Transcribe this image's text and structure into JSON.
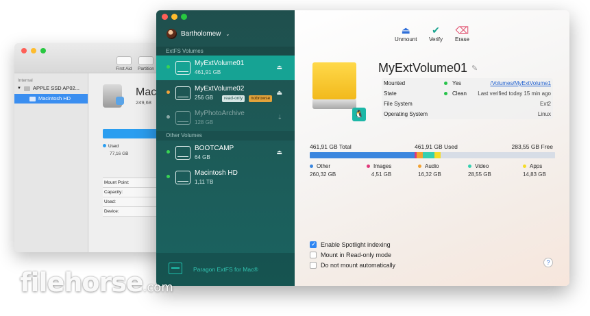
{
  "background_window": {
    "toolbar": [
      "First Aid",
      "Partition"
    ],
    "sidebar_section": "Internal",
    "sidebar_items": [
      "APPLE SSD AP02...",
      "Macintosh HD"
    ],
    "disk_name": "Macin",
    "disk_size": "249,68",
    "used_label": "Used",
    "used_value": "77,16 GB",
    "info_rows": [
      "Mount Point:",
      "Capacity:",
      "Used:",
      "Device:"
    ]
  },
  "sidebar": {
    "user": "Bartholomew",
    "sections": {
      "extfs": "ExtFS Volumes",
      "other": "Other Volumes"
    },
    "volumes": [
      {
        "name": "MyExtVolume01",
        "size": "461,91 GB",
        "status_color": "#39d353"
      },
      {
        "name": "MyExtVolume02",
        "size": "256 GB",
        "status_color": "#f3a33a",
        "badges": [
          "read-only",
          "nobrowse"
        ]
      },
      {
        "name": "MyPhotoArchive",
        "size": "128 GB",
        "status_color": "#8aa8a6"
      },
      {
        "name": "BOOTCAMP",
        "size": "64 GB",
        "status_color": "#39d353"
      },
      {
        "name": "Macintosh HD",
        "size": "1,11 TB",
        "status_color": "#39d353"
      }
    ],
    "brand": "Paragon ExtFS for Mac®"
  },
  "toolbar": {
    "unmount": "Unmount",
    "verify": "Verify",
    "erase": "Erase"
  },
  "volume": {
    "title": "MyExtVolume01",
    "info": {
      "mounted_label": "Mounted",
      "mounted_value": "Yes",
      "mount_path": "/Volumes/MyExtVolume1",
      "state_label": "State",
      "state_value": "Clean",
      "state_note": "Last verified today 15 min ago",
      "fs_label": "File System",
      "fs_value": "Ext2",
      "os_label": "Operating System",
      "os_value": "Linux"
    }
  },
  "capacity": {
    "total": "461,91 GB Total",
    "used": "461,91 GB Used",
    "free": "283,55 GB Free",
    "categories": [
      {
        "name": "Other",
        "value": "260,32 GB",
        "gb": 260.32,
        "color": "#3b86de"
      },
      {
        "name": "Images",
        "value": "4,51 GB",
        "gb": 4.51,
        "color": "#e0387a"
      },
      {
        "name": "Audio",
        "value": "16,32 GB",
        "gb": 16.32,
        "color": "#f2a232"
      },
      {
        "name": "Video",
        "value": "28,55 GB",
        "gb": 28.55,
        "color": "#35d0b0"
      },
      {
        "name": "Apps",
        "value": "14,83 GB",
        "gb": 14.83,
        "color": "#f5dc28"
      }
    ],
    "free_gb": 283.55,
    "free_color": "#d7dde6"
  },
  "options": [
    {
      "label": "Enable Spotlight indexing",
      "checked": true
    },
    {
      "label": "Mount in Read-only mode",
      "checked": false
    },
    {
      "label": "Do not mount automatically",
      "checked": false
    }
  ],
  "help": "?",
  "watermark": {
    "main": "filehorse",
    "suffix": ".com"
  }
}
